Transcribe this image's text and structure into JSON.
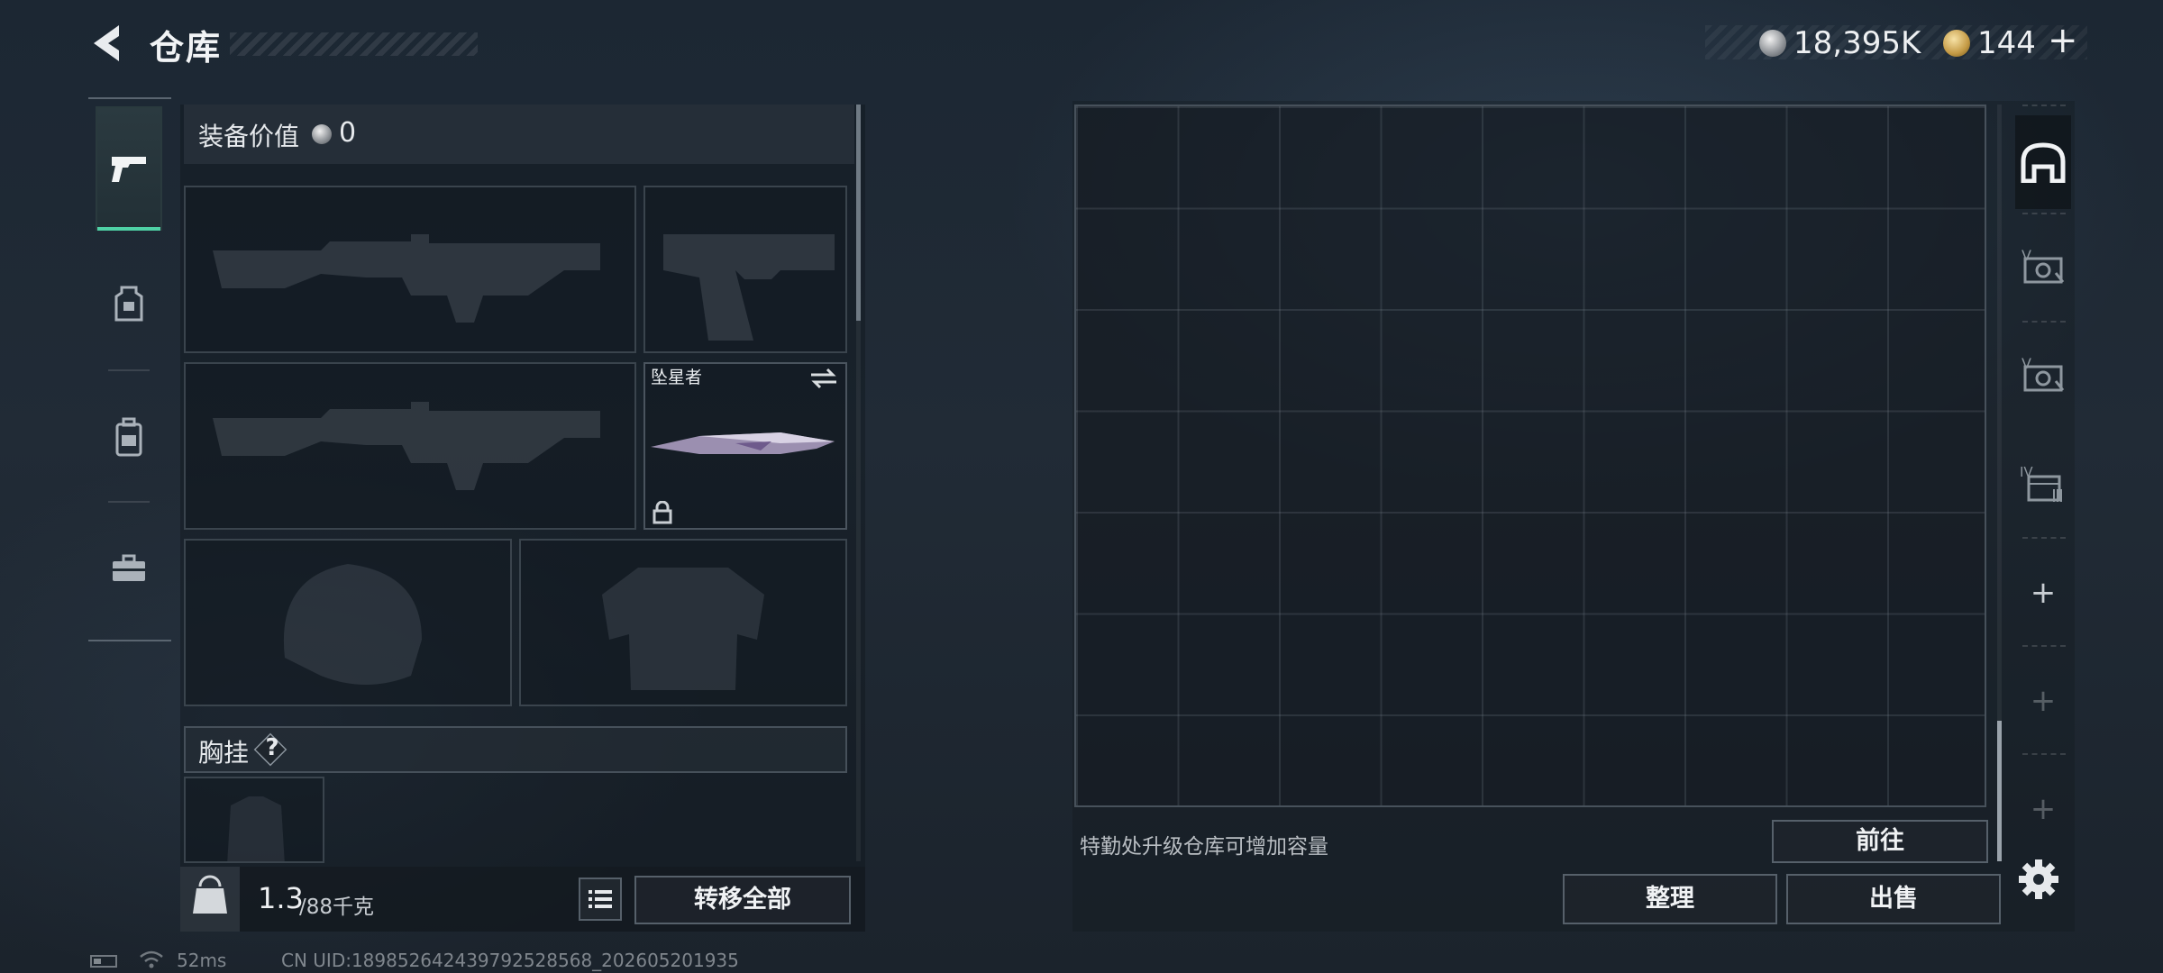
{
  "header": {
    "title": "仓库",
    "currency_silver": "18,395K",
    "currency_gold": "144",
    "currency_gold_add": "+"
  },
  "equipment": {
    "value_label": "装备价值",
    "value": "0",
    "knife_name": "坠星者",
    "chest_label": "胸挂",
    "chest_help": "?"
  },
  "weight": {
    "current": "1.3",
    "capacity": "/88千克",
    "icon_text": "KG"
  },
  "actions": {
    "transfer_all": "转移全部",
    "go": "前往",
    "sort": "整理",
    "sell": "出售"
  },
  "storage": {
    "hint": "特勤处升级仓库可增加容量",
    "tabs": [
      {
        "label": "",
        "roman": ""
      },
      {
        "label": "",
        "roman": "V"
      },
      {
        "label": "",
        "roman": "V"
      },
      {
        "label": "",
        "roman": "IV"
      }
    ]
  },
  "status_bar": {
    "ping": "52ms",
    "uid": "CN UID:18985264243979252856​8_202605201935"
  },
  "colors": {
    "accent": "#4fd1a5",
    "panel_border": "#3a444d"
  }
}
